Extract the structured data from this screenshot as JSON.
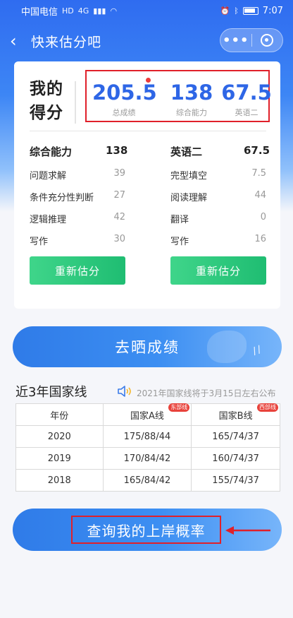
{
  "status_bar": {
    "carrier": "中国电信",
    "network": "4G",
    "time": "7:07"
  },
  "nav": {
    "title": "快来估分吧",
    "more": "•••"
  },
  "score_card": {
    "label_line1": "我的",
    "label_line2": "得分",
    "scores": [
      {
        "value": "205.5",
        "label": "总成绩"
      },
      {
        "value": "138",
        "label": "综合能力"
      },
      {
        "value": "67.5",
        "label": "英语二"
      }
    ],
    "subjects": [
      {
        "name": "综合能力",
        "total": "138",
        "items": [
          {
            "name": "问题求解",
            "score": "39"
          },
          {
            "name": "条件充分性判断",
            "score": "27"
          },
          {
            "name": "逻辑推理",
            "score": "42"
          },
          {
            "name": "写作",
            "score": "30"
          }
        ],
        "button": "重新估分"
      },
      {
        "name": "英语二",
        "total": "67.5",
        "items": [
          {
            "name": "完型填空",
            "score": "7.5"
          },
          {
            "name": "阅读理解",
            "score": "44"
          },
          {
            "name": "翻译",
            "score": "0"
          },
          {
            "name": "写作",
            "score": "16"
          }
        ],
        "button": "重新估分"
      }
    ]
  },
  "share_button": "去晒成绩",
  "national_line": {
    "title": "近3年国家线",
    "note": "2021年国家线将于3月15日左右公布",
    "headers": [
      "年份",
      "国家A线",
      "国家B线"
    ],
    "tags": [
      "东部线",
      "西部线"
    ],
    "rows": [
      [
        "2020",
        "175/88/44",
        "165/74/37"
      ],
      [
        "2019",
        "170/84/42",
        "160/74/37"
      ],
      [
        "2018",
        "165/84/42",
        "155/74/37"
      ]
    ]
  },
  "query_button": "查询我的上岸概率",
  "colors": {
    "accent_blue": "#2e66e6",
    "green": "#1fbd72",
    "highlight_red": "#e0202a"
  }
}
